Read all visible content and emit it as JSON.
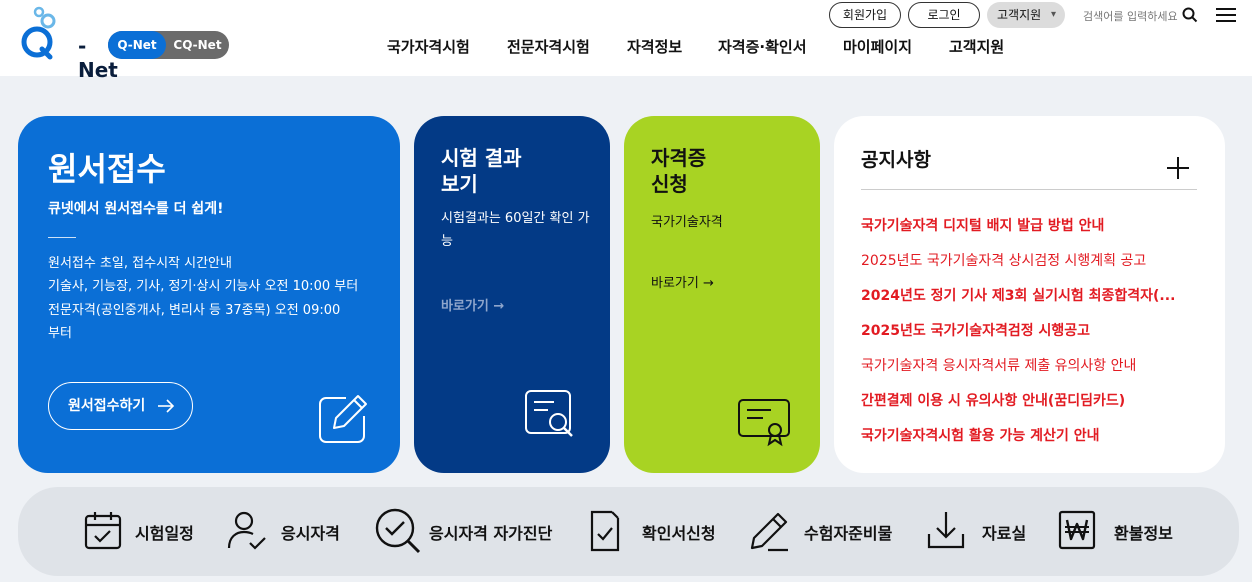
{
  "brand": {
    "logo_text": "-Net",
    "toggle": [
      "Q-Net",
      "CQ-Net"
    ]
  },
  "util": {
    "signup": "회원가입",
    "login": "로그인",
    "support": "고객지원",
    "search_placeholder": "검색어를 입력하세요"
  },
  "nav": [
    "국가자격시험",
    "전문자격시험",
    "자격정보",
    "자격증·확인서",
    "마이페이지",
    "고객지원"
  ],
  "apply": {
    "title": "원서접수",
    "subtitle": "큐넷에서 원서접수를 더 쉽게!",
    "info": [
      "원서접수 초일, 접수시작 시간안내",
      "기술사, 기능장, 기사, 정기·상시 기능사 오전 10:00 부터",
      "전문자격(공인중개사, 변리사 등 37종목) 오전 09:00",
      "부터"
    ],
    "button": "원서접수하기"
  },
  "result": {
    "title_line1": "시험 결과",
    "title_line2": "보기",
    "desc": "시험결과는 60일간 확인 가능",
    "link": "바로가기"
  },
  "cert": {
    "title_line1": "자격증",
    "title_line2": "신청",
    "desc": "국가기술자격",
    "link": "바로가기"
  },
  "notices": {
    "title": "공지사항",
    "items": [
      "국가기술자격 디지털 배지 발급 방법 안내",
      "2025년도 국가기술자격 상시검정 시행계획 공고",
      "2024년도 정기 기사 제3회 실기시험 최종합격자(...",
      "2025년도 국가기술자격검정 시행공고",
      "국가기술자격 응시자격서류 제출 유의사항 안내",
      "간편결제 이용 시 유의사항 안내(꿈디딤카드)",
      "국가기술자격시험 활용 가능 계산기 안내"
    ]
  },
  "quick": [
    "시험일정",
    "응시자격",
    "응시자격 자가진단",
    "확인서신청",
    "수험자준비물",
    "자료실",
    "환불정보"
  ],
  "colors": {
    "primary": "#0b6fd6",
    "navy": "#033a86",
    "lime": "#a8d323",
    "notice_red": "#e21b22"
  }
}
